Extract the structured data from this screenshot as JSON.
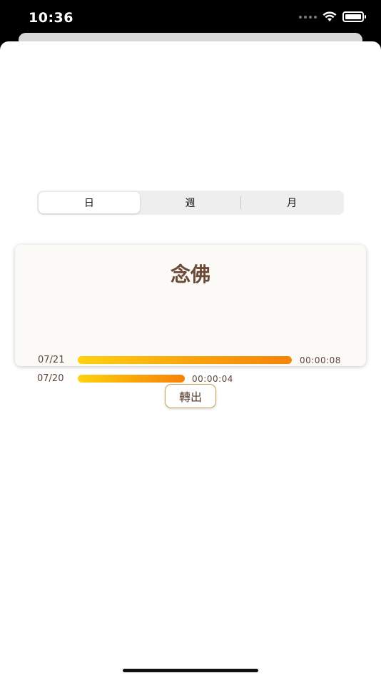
{
  "status_bar": {
    "time": "10:36",
    "icons": [
      "signal-dots-icon",
      "wifi-icon",
      "battery-icon"
    ]
  },
  "segmented_control": {
    "options": [
      "日",
      "週",
      "月"
    ],
    "selected_index": 0
  },
  "stats_card": {
    "title": "念佛",
    "rows": [
      {
        "date": "07/21",
        "duration": "00:00:08",
        "progress": 1.0
      },
      {
        "date": "07/20",
        "duration": "00:00:04",
        "progress": 0.5
      }
    ],
    "bar_gradient": [
      "#ffd20e",
      "#f6830a"
    ]
  },
  "export_button": {
    "label": "轉出"
  },
  "colors": {
    "accent_brown": "#6b4a37",
    "export_border": "#c8a25e",
    "card_bg": "#fcfaf7"
  }
}
